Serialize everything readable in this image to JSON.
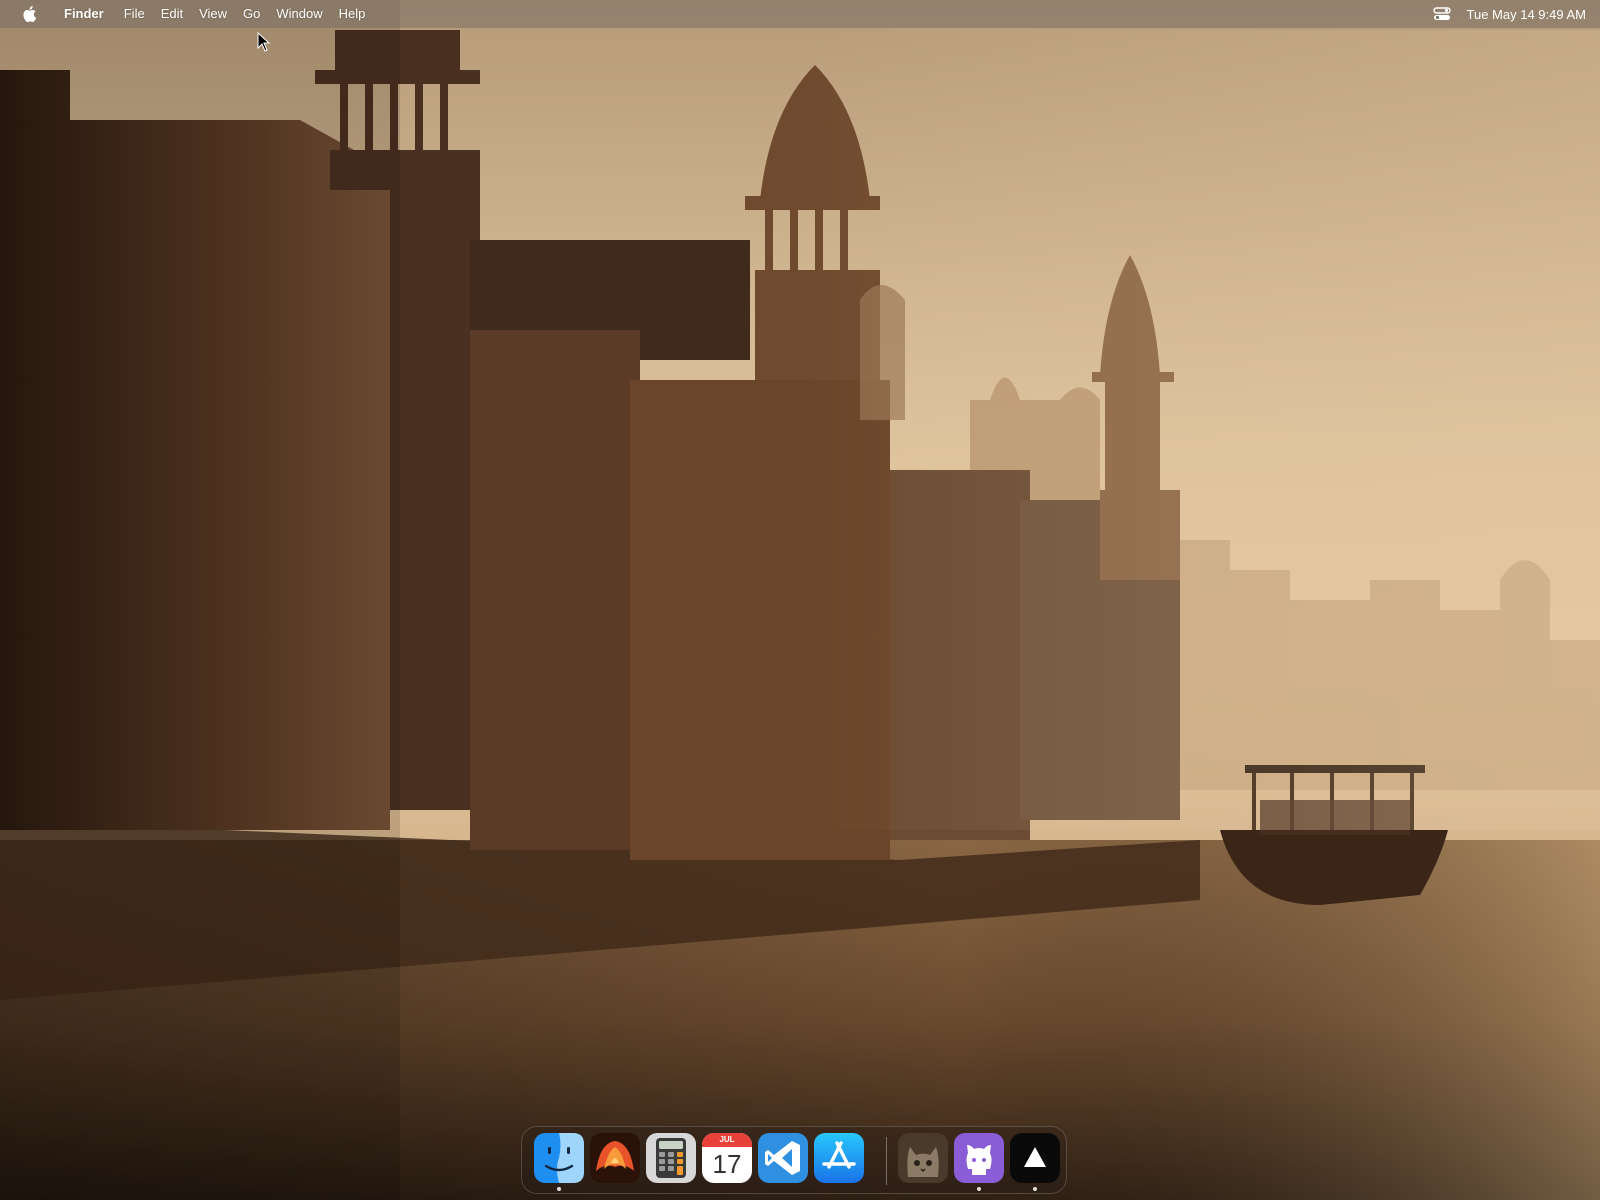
{
  "menubar": {
    "app_name": "Finder",
    "menus": [
      "File",
      "Edit",
      "View",
      "Go",
      "Window",
      "Help"
    ],
    "icons": {
      "apple": "apple-logo-icon",
      "control_center": "control-center-icon"
    },
    "clock": "Tue May 14  9:49 AM"
  },
  "dock": {
    "items": [
      {
        "name": "finder",
        "icon": "finder-icon",
        "running": true
      },
      {
        "name": "macos-wallpaper-app",
        "icon": "orange-flower-icon",
        "running": false
      },
      {
        "name": "calculator",
        "icon": "calculator-icon",
        "running": false
      },
      {
        "name": "calendar",
        "icon": "calendar-icon",
        "running": false,
        "month": "JUL",
        "day": "17"
      },
      {
        "name": "visual-studio-code",
        "icon": "vscode-icon",
        "running": false
      },
      {
        "name": "app-store",
        "icon": "app-store-icon",
        "running": false
      },
      {
        "name": "cat-app",
        "icon": "cat-icon",
        "running": false
      },
      {
        "name": "github-desktop",
        "icon": "github-icon",
        "running": true
      },
      {
        "name": "triangle-app",
        "icon": "triangle-icon",
        "running": true
      }
    ]
  },
  "colors": {
    "menubar_bg": "#786e64",
    "wallpaper_sky": "#d9bf98",
    "wallpaper_dark": "#3a2717",
    "calendar_red": "#e8413a"
  }
}
